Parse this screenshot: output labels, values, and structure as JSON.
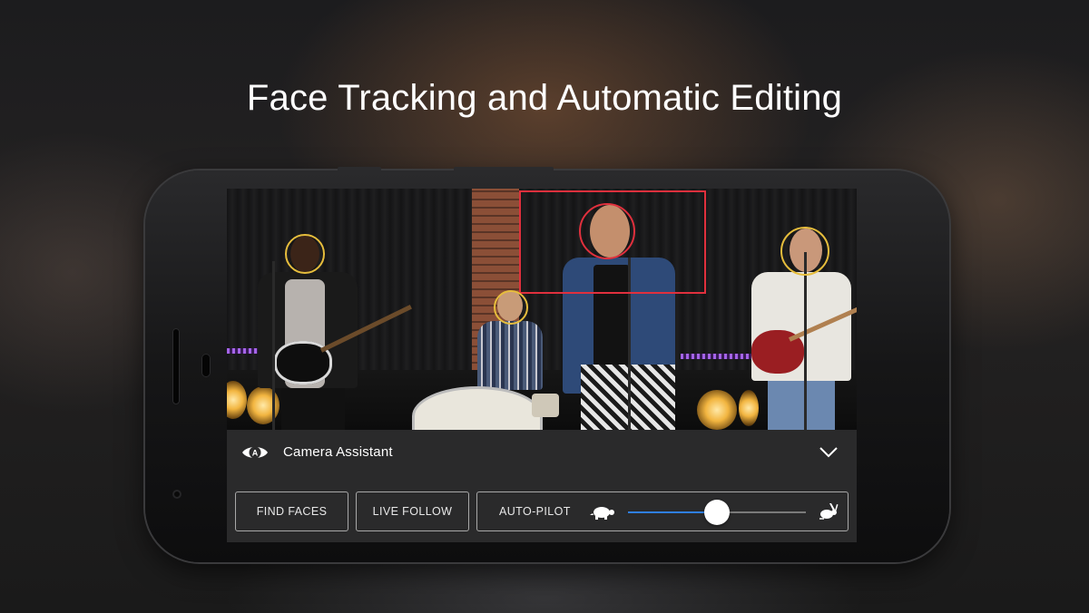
{
  "headline": "Face Tracking and Automatic Editing",
  "camera_assistant": {
    "label": "Camera Assistant",
    "icon": "eye-a-icon",
    "expand_icon": "chevron-down-icon"
  },
  "buttons": {
    "find_faces": "FIND FACES",
    "live_follow": "LIVE FOLLOW",
    "auto_pilot": "AUTO-PILOT"
  },
  "auto_pilot_speed": {
    "value": 0.5,
    "min_icon": "turtle-icon",
    "max_icon": "hare-icon"
  },
  "colors": {
    "face_ring": "#e6bd3c",
    "active_face": "#e0303d",
    "slider_fill": "#2f7fe0"
  }
}
